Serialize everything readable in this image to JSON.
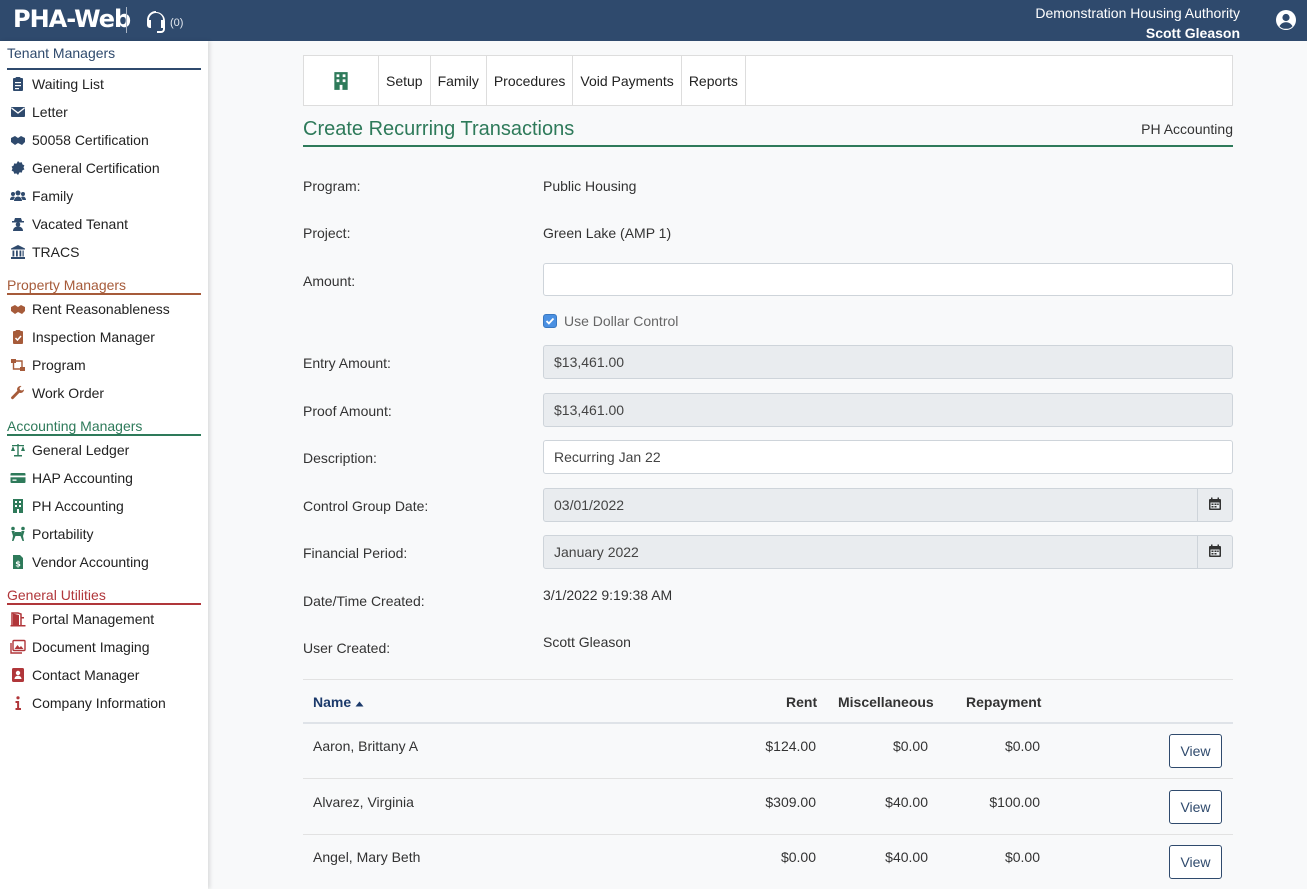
{
  "header": {
    "logo": "PHA-Web",
    "support_count": "(0)",
    "org_name": "Demonstration Housing Authority",
    "user_name": "Scott Gleason"
  },
  "sidebar": {
    "sections": [
      {
        "title": "Tenant Managers",
        "items": [
          "Waiting List",
          "Letter",
          "50058 Certification",
          "General Certification",
          "Family",
          "Vacated Tenant",
          "TRACS"
        ]
      },
      {
        "title": "Property Managers",
        "items": [
          "Rent Reasonableness",
          "Inspection Manager",
          "Program",
          "Work Order"
        ]
      },
      {
        "title": "Accounting Managers",
        "items": [
          "General Ledger",
          "HAP Accounting",
          "PH Accounting",
          "Portability",
          "Vendor Accounting"
        ]
      },
      {
        "title": "General Utilities",
        "items": [
          "Portal Management",
          "Document Imaging",
          "Contact Manager",
          "Company Information"
        ]
      }
    ]
  },
  "menu": [
    "Setup",
    "Family",
    "Procedures",
    "Void Payments",
    "Reports"
  ],
  "page": {
    "title": "Create Recurring Transactions",
    "module": "PH Accounting"
  },
  "form": {
    "program_label": "Program:",
    "program_value": "Public Housing",
    "project_label": "Project:",
    "project_value": "Green Lake (AMP 1)",
    "amount_label": "Amount:",
    "amount_value": "",
    "dollar_control_label": "Use Dollar Control",
    "entry_label": "Entry Amount:",
    "entry_value": "$13,461.00",
    "proof_label": "Proof Amount:",
    "proof_value": "$13,461.00",
    "description_label": "Description:",
    "description_value": "Recurring Jan 22",
    "control_date_label": "Control Group Date:",
    "control_date_value": "03/01/2022",
    "financial_period_label": "Financial Period:",
    "financial_period_value": "January 2022",
    "created_label": "Date/Time Created:",
    "created_value": "3/1/2022 9:19:38 AM",
    "user_label": "User Created:",
    "user_value": "Scott Gleason"
  },
  "table": {
    "headers": {
      "name": "Name",
      "rent": "Rent",
      "misc": "Miscellaneous",
      "repayment": "Repayment"
    },
    "view_label": "View",
    "rows": [
      {
        "name": "Aaron, Brittany A",
        "rent": "$124.00",
        "misc": "$0.00",
        "repayment": "$0.00"
      },
      {
        "name": "Alvarez, Virginia",
        "rent": "$309.00",
        "misc": "$40.00",
        "repayment": "$100.00"
      },
      {
        "name": "Angel, Mary Beth",
        "rent": "$0.00",
        "misc": "$40.00",
        "repayment": "$0.00"
      }
    ]
  },
  "colors": {
    "header_bg": "#2f4a6d",
    "accent_green": "#2e7a5a",
    "property": "#a65b3a",
    "utilities": "#b0363a"
  }
}
